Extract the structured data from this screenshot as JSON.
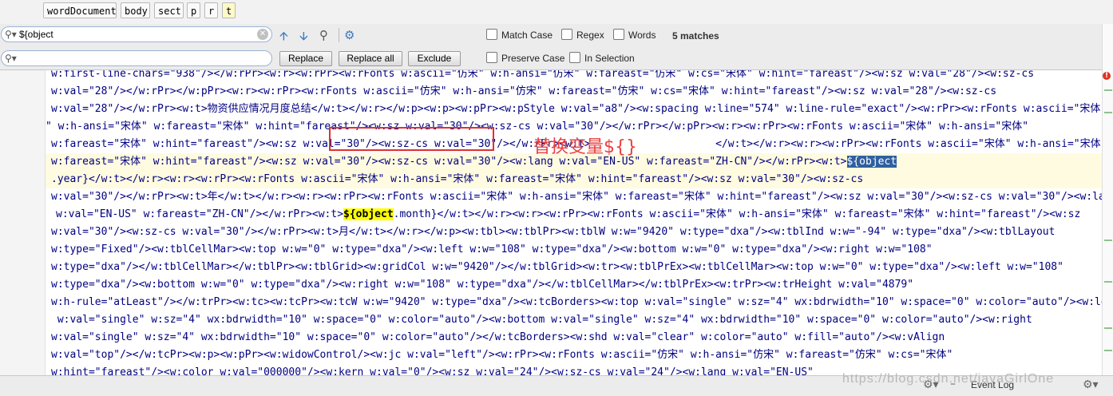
{
  "breadcrumbs": [
    "wordDocument",
    "body",
    "sect",
    "p",
    "r",
    "t"
  ],
  "find": {
    "search_value": "${object",
    "replace_value": "",
    "buttons": {
      "replace": "Replace",
      "replace_all": "Replace all",
      "exclude": "Exclude"
    },
    "options": {
      "match_case": "Match Case",
      "regex": "Regex",
      "words": "Words",
      "preserve_case": "Preserve Case",
      "in_selection": "In Selection"
    },
    "match_count": "5 matches"
  },
  "editor": {
    "lines": [
      {
        "text": "w:first-line-chars=\"938\"/></w:rPr><w:r><w:rPr><w:rFonts w:ascii=\"仿宋\" w:h-ansi=\"仿宋\" w:fareast=\"仿宋\" w:cs=\"宋体\" w:hint=\"fareast\"/><w:sz w:val=\"28\"/><w:sz-cs"
      },
      {
        "text": "w:val=\"28\"/></w:rPr></w:pPr><w:r><w:rPr><w:rFonts w:ascii=\"仿宋\" w:h-ansi=\"仿宋\" w:fareast=\"仿宋\" w:cs=\"宋体\" w:hint=\"fareast\"/><w:sz w:val=\"28\"/><w:sz-cs"
      },
      {
        "text": "w:val=\"28\"/></w:rPr><w:t>物资供应情况月度总结</w:t></w:r></w:p><w:p><w:pPr><w:pStyle w:val=\"a8\"/><w:spacing w:line=\"574\" w:line-rule=\"exact\"/><w:rPr><w:rFonts w:ascii=\"宋体\""
      },
      {
        "text": "\" w:h-ansi=\"宋体\" w:fareast=\"宋体\" w:hint=\"fareast\"/><w:sz w:val=\"30\"/><w:sz-cs w:val=\"30\"/></w:rPr></w:pPr><w:r><w:rPr><w:rFonts w:ascii=\"宋体\" w:h-ansi=\"宋体\""
      },
      {
        "text": "w:fareast=\"宋体\" w:hint=\"fareast\"/><w:sz w:val=\"30\"/><w:sz-cs w:val=\"30\"/></w:rPr><w:t>                    </w:t></w:r><w:r><w:rPr><w:rFonts w:ascii=\"宋体\" w:h-ansi=\"宋体\""
      },
      {
        "text": "w:fareast=\"宋体\" w:hint=\"fareast\"/><w:sz w:val=\"30\"/><w:sz-cs w:val=\"30\"/><w:lang w:val=\"EN-US\" w:fareast=\"ZH-CN\"/></w:rPr><w:t>",
        "selected": "${object"
      },
      {
        "text": ".year}</w:t></w:r><w:r><w:rPr><w:rFonts w:ascii=\"宋体\" w:h-ansi=\"宋体\" w:fareast=\"宋体\" w:hint=\"fareast\"/><w:sz w:val=\"30\"/><w:sz-cs"
      },
      {
        "text": "w:val=\"30\"/></w:rPr><w:t>年</w:t></w:r><w:r><w:rPr><w:rFonts w:ascii=\"宋体\" w:h-ansi=\"宋体\" w:fareast=\"宋体\" w:hint=\"fareast\"/><w:sz w:val=\"30\"/><w:sz-cs w:val=\"30\"/><w:la"
      },
      {
        "text": "w:val=\"EN-US\" w:fareast=\"ZH-CN\"/></w:rPr><w:t>",
        "hit": "${object",
        "after": ".month}</w:t></w:r><w:r><w:rPr><w:rFonts w:ascii=\"宋体\" w:h-ansi=\"宋体\" w:fareast=\"宋体\" w:hint=\"fareast\"/><w:sz"
      },
      {
        "text": "w:val=\"30\"/><w:sz-cs w:val=\"30\"/></w:rPr><w:t>月</w:t></w:r></w:p><w:tbl><w:tblPr><w:tblW w:w=\"9420\" w:type=\"dxa\"/><w:tblInd w:w=\"-94\" w:type=\"dxa\"/><w:tblLayout"
      },
      {
        "text": "w:type=\"Fixed\"/><w:tblCellMar><w:top w:w=\"0\" w:type=\"dxa\"/><w:left w:w=\"108\" w:type=\"dxa\"/><w:bottom w:w=\"0\" w:type=\"dxa\"/><w:right w:w=\"108\""
      },
      {
        "text": "w:type=\"dxa\"/></w:tblCellMar></w:tblPr><w:tblGrid><w:gridCol w:w=\"9420\"/></w:tblGrid><w:tr><w:tblPrEx><w:tblCellMar><w:top w:w=\"0\" w:type=\"dxa\"/><w:left w:w=\"108\""
      },
      {
        "text": "w:type=\"dxa\"/><w:bottom w:w=\"0\" w:type=\"dxa\"/><w:right w:w=\"108\" w:type=\"dxa\"/></w:tblCellMar></w:tblPrEx><w:trPr><w:trHeight w:val=\"4879\""
      },
      {
        "text": "w:h-rule=\"atLeast\"/></w:trPr><w:tc><w:tcPr><w:tcW w:w=\"9420\" w:type=\"dxa\"/><w:tcBorders><w:top w:val=\"single\" w:sz=\"4\" wx:bdrwidth=\"10\" w:space=\"0\" w:color=\"auto\"/><w:le"
      },
      {
        "text": " w:val=\"single\" w:sz=\"4\" wx:bdrwidth=\"10\" w:space=\"0\" w:color=\"auto\"/><w:bottom w:val=\"single\" w:sz=\"4\" wx:bdrwidth=\"10\" w:space=\"0\" w:color=\"auto\"/><w:right"
      },
      {
        "text": "w:val=\"single\" w:sz=\"4\" wx:bdrwidth=\"10\" w:space=\"0\" w:color=\"auto\"/></w:tcBorders><w:shd w:val=\"clear\" w:color=\"auto\" w:fill=\"auto\"/><w:vAlign"
      },
      {
        "text": "w:val=\"top\"/></w:tcPr><w:p><w:pPr><w:widowControl/><w:jc w:val=\"left\"/><w:rPr><w:rFonts w:ascii=\"仿宋\" w:h-ansi=\"仿宋\" w:fareast=\"仿宋\" w:cs=\"宋体\""
      },
      {
        "text": "w:hint=\"fareast\"/><w:color w:val=\"000000\"/><w:kern w:val=\"0\"/><w:sz w:val=\"24\"/><w:sz-cs w:val=\"24\"/><w:lang w:val=\"EN-US\""
      }
    ]
  },
  "annotation": "替换变量${}",
  "status": {
    "event_log": "Event Log"
  },
  "watermark": "https://blog.csdn.net/javaGirlOne",
  "icons": [
    "search-icon",
    "clear-icon",
    "prev-occurrence-icon",
    "next-occurrence-icon",
    "find-all-icon",
    "settings-icon",
    "error-icon"
  ]
}
